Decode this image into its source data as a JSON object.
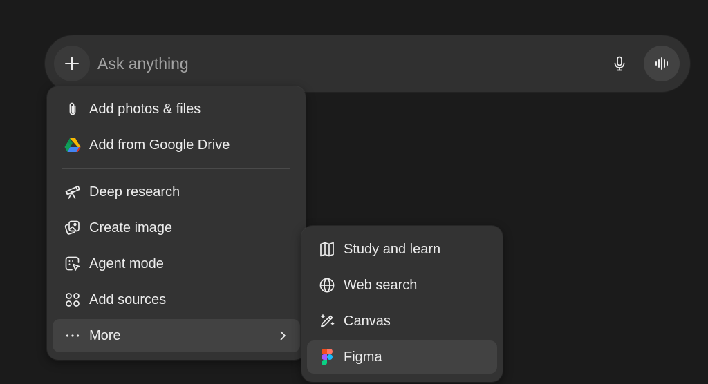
{
  "composer": {
    "placeholder": "Ask anything",
    "icons": {
      "add": "plus-icon",
      "mic": "microphone-icon",
      "voice": "voice-waveform-icon"
    }
  },
  "menu": {
    "items": [
      {
        "label": "Add photos & files",
        "icon": "paperclip-icon"
      },
      {
        "label": "Add from Google Drive",
        "icon": "google-drive-icon"
      },
      {
        "label": "Deep research",
        "icon": "telescope-icon"
      },
      {
        "label": "Create image",
        "icon": "image-icon"
      },
      {
        "label": "Agent mode",
        "icon": "agent-cursor-icon"
      },
      {
        "label": "Add sources",
        "icon": "sources-icon"
      },
      {
        "label": "More",
        "icon": "more-dots-icon"
      }
    ]
  },
  "submenu": {
    "items": [
      {
        "label": "Study and learn",
        "icon": "book-icon"
      },
      {
        "label": "Web search",
        "icon": "globe-icon"
      },
      {
        "label": "Canvas",
        "icon": "pen-sparkle-icon"
      },
      {
        "label": "Figma",
        "icon": "figma-icon"
      }
    ]
  },
  "colors": {
    "background": "#1b1b1b",
    "composer": "#303030",
    "menu": "#333333",
    "highlight": "#424242",
    "text": "#ececec",
    "placeholder": "#a3a3a3"
  }
}
